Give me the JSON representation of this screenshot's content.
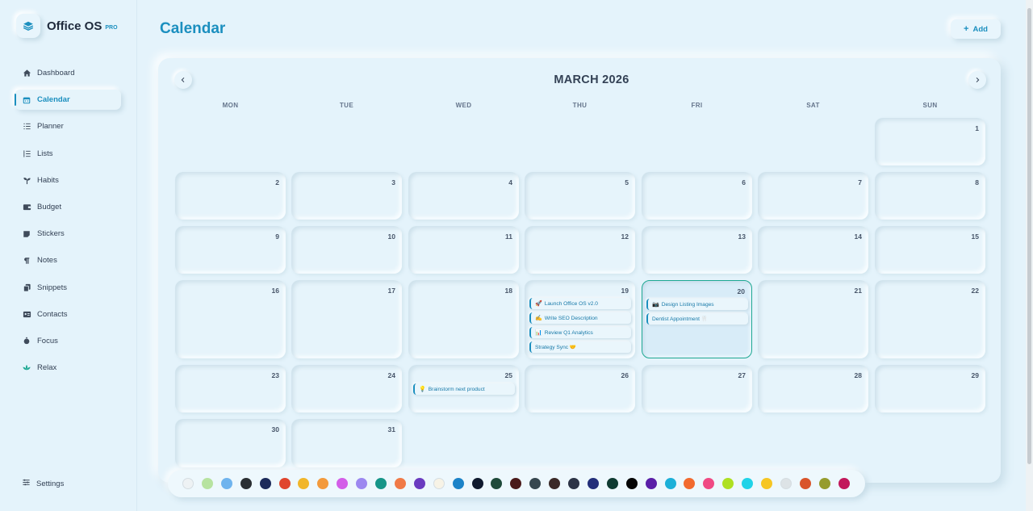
{
  "brand": {
    "name": "Office OS",
    "badge": "PRO"
  },
  "sidebar": {
    "items": [
      {
        "label": "Dashboard",
        "icon": "home-icon"
      },
      {
        "label": "Calendar",
        "icon": "calendar-icon",
        "active": true
      },
      {
        "label": "Planner",
        "icon": "planner-icon"
      },
      {
        "label": "Lists",
        "icon": "list-icon"
      },
      {
        "label": "Habits",
        "icon": "sprout-icon"
      },
      {
        "label": "Budget",
        "icon": "wallet-icon"
      },
      {
        "label": "Stickers",
        "icon": "sticker-icon"
      },
      {
        "label": "Notes",
        "icon": "pilcrow-icon"
      },
      {
        "label": "Snippets",
        "icon": "copy-icon"
      },
      {
        "label": "Contacts",
        "icon": "contact-card-icon"
      },
      {
        "label": "Focus",
        "icon": "timer-icon"
      },
      {
        "label": "Relax",
        "icon": "lotus-icon"
      }
    ],
    "settings_label": "Settings"
  },
  "header": {
    "title": "Calendar",
    "add_label": "Add"
  },
  "calendar": {
    "month_label": "MARCH 2026",
    "weekdays": [
      "MON",
      "TUE",
      "WED",
      "THU",
      "FRI",
      "SAT",
      "SUN"
    ],
    "days": [
      "1",
      "2",
      "3",
      "4",
      "5",
      "6",
      "7",
      "8",
      "9",
      "10",
      "11",
      "12",
      "13",
      "14",
      "15",
      "16",
      "17",
      "18",
      "19",
      "20",
      "21",
      "22",
      "23",
      "24",
      "25",
      "26",
      "27",
      "28",
      "29",
      "30",
      "31"
    ],
    "today": "20",
    "events": [
      {
        "day": "19",
        "icon": "🚀",
        "label": "Launch Office OS v2.0"
      },
      {
        "day": "19",
        "icon": "✍️",
        "label": "Write SEO Description"
      },
      {
        "day": "19",
        "icon": "📊",
        "label": "Review Q1 Analytics"
      },
      {
        "day": "19",
        "icon": "",
        "label": "Strategy Sync 🤝"
      },
      {
        "day": "20",
        "icon": "📷",
        "label": "Design Listing Images"
      },
      {
        "day": "20",
        "icon": "",
        "label": "Dentist Appointment 🦷"
      },
      {
        "day": "25",
        "icon": "💡",
        "label": "Brainstorm next product"
      }
    ]
  },
  "palette": {
    "colors": [
      "#eef2f4",
      "#b7e3a0",
      "#6fb4ee",
      "#2b2f33",
      "#1c2a5a",
      "#e0452e",
      "#f1b62a",
      "#f39a3c",
      "#d35ee8",
      "#9c88f0",
      "#169588",
      "#f07a47",
      "#6a3bc0",
      "#f7f3e6",
      "#1c83c8",
      "#0f1a2e",
      "#1f4a3a",
      "#4a1a1a",
      "#36474f",
      "#3b2a28",
      "#2c3446",
      "#232f7a",
      "#0f3b32",
      "#050505",
      "#5a1fa8",
      "#1cb0d8",
      "#f26a2e",
      "#f04a84",
      "#aee021",
      "#20d3e8",
      "#f6c623",
      "#dde3e6",
      "#d9542a",
      "#969c2e",
      "#c2185b"
    ]
  }
}
